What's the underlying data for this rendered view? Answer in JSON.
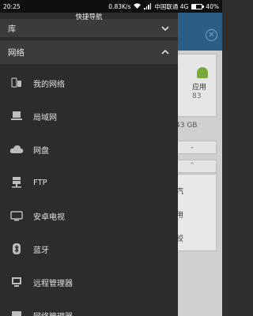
{
  "status_bar": {
    "time": "20:25",
    "network_speed": "0.83K/s",
    "carrier": "中国联通 4G",
    "battery": "40%",
    "battery_level": 0.4
  },
  "drawer": {
    "title": "快捷导航",
    "library_section": {
      "label": "库"
    },
    "network_section": {
      "label": "网络"
    },
    "items": [
      {
        "label": "我的网络",
        "icon": "my-network-icon"
      },
      {
        "label": "局域网",
        "icon": "lan-computer-icon"
      },
      {
        "label": "网盘",
        "icon": "cloud-icon"
      },
      {
        "label": "FTP",
        "icon": "ftp-server-icon"
      },
      {
        "label": "安卓电视",
        "icon": "tv-icon"
      },
      {
        "label": "蓝牙",
        "icon": "bluetooth-icon"
      },
      {
        "label": "远程管理器",
        "icon": "remote-manager-icon"
      },
      {
        "label": "网络管理器",
        "icon": "network-manager-icon"
      }
    ]
  },
  "background": {
    "card_label": "应用",
    "card_count": "83",
    "storage_text": "43 GB",
    "panel_line_1": "汽",
    "panel_line_2": "用",
    "panel_line_3": "绞",
    "accent": "#2d5d83"
  }
}
